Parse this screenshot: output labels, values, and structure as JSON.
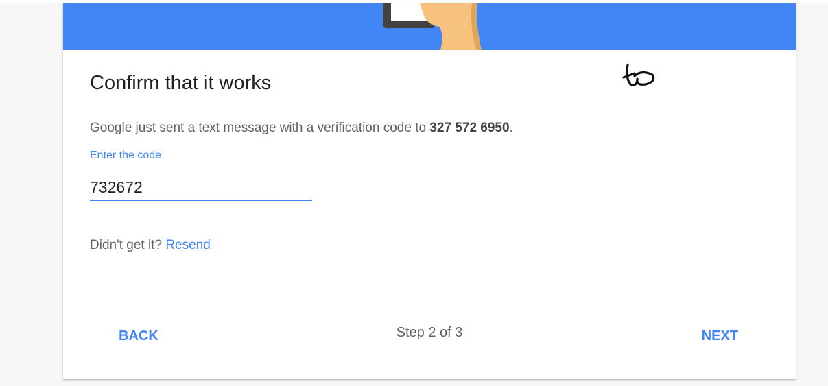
{
  "dialog": {
    "title": "Confirm that it works",
    "message_prefix": "Google just sent a text message with a verification code to ",
    "phone_number": "327 572 6950",
    "message_suffix": ".",
    "code_label": "Enter the code",
    "code_value": "732672",
    "resend_prompt": "Didn't get it?",
    "resend_link": "Resend"
  },
  "footer": {
    "back_label": "BACK",
    "step_text": "Step 2 of 3",
    "next_label": "NEXT"
  },
  "icons": {
    "hero": "phone-in-hand-illustration",
    "scribble": "handwritten-scribble"
  },
  "colors": {
    "accent": "#4285f4",
    "title_text": "#212121",
    "body_text": "#616161"
  }
}
